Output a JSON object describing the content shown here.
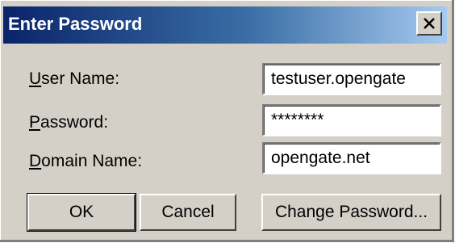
{
  "window": {
    "title": "Enter Password",
    "close_symbol": "close-icon"
  },
  "form": {
    "username_label": {
      "mnemonic": "U",
      "rest": "ser Name:"
    },
    "username_value": "testuser.opengate",
    "password_label": {
      "mnemonic": "P",
      "rest": "assword:"
    },
    "password_value": "********",
    "domain_label": {
      "mnemonic": "D",
      "rest": "omain Name:"
    },
    "domain_value": "opengate.net"
  },
  "buttons": {
    "ok": "OK",
    "cancel": "Cancel",
    "change_password": "Change Password..."
  },
  "colors": {
    "titlebar_start": "#0a246a",
    "titlebar_end": "#a6caf0",
    "face": "#d4d0c8"
  }
}
